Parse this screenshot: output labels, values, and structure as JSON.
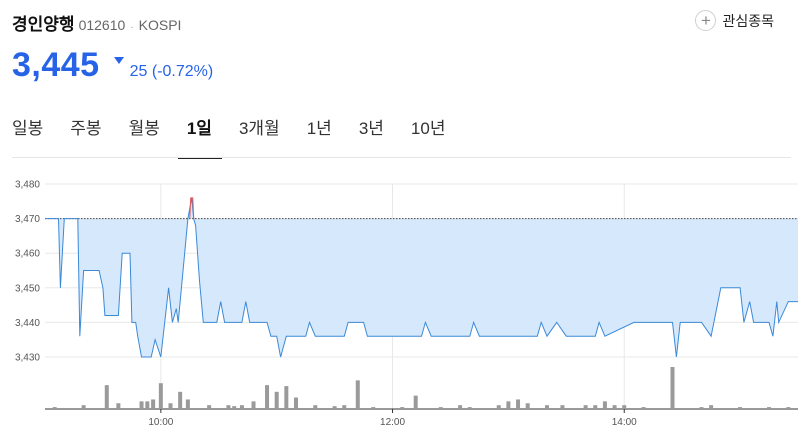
{
  "stock": {
    "name": "경인양행",
    "code": "012610",
    "separator": "·",
    "market": "KOSPI",
    "price": "3,445",
    "change_text": "25 (-0.72%)",
    "direction": "down"
  },
  "watch": {
    "icon": "plus-icon",
    "label": "관심종목"
  },
  "tabs": [
    {
      "label": "일봉"
    },
    {
      "label": "주봉"
    },
    {
      "label": "월봉"
    },
    {
      "label": "1일",
      "active": true
    },
    {
      "label": "3개월"
    },
    {
      "label": "1년"
    },
    {
      "label": "3년"
    },
    {
      "label": "10년"
    }
  ],
  "colors": {
    "accent": "#2763e6",
    "line": "#3b8ad8",
    "fill": "#d6e8fb",
    "peak": "#e05555",
    "volume": "#9a9a9a"
  },
  "chart_data": {
    "type": "line",
    "y_ticks": [
      "3,480",
      "3,470",
      "3,460",
      "3,450",
      "3,440",
      "3,430"
    ],
    "x_ticks": [
      "10:00",
      "12:00",
      "14:00"
    ],
    "ylim": [
      3430,
      3480
    ],
    "reference_price": 3470,
    "time_range": [
      "09:00",
      "15:30"
    ],
    "price_series": [
      [
        "09:00",
        3470
      ],
      [
        "09:07",
        3470
      ],
      [
        "09:08",
        3450
      ],
      [
        "09:10",
        3470
      ],
      [
        "09:15",
        3470
      ],
      [
        "09:17",
        3470
      ],
      [
        "09:18",
        3436
      ],
      [
        "09:20",
        3455
      ],
      [
        "09:28",
        3455
      ],
      [
        "09:30",
        3450
      ],
      [
        "09:31",
        3442
      ],
      [
        "09:38",
        3442
      ],
      [
        "09:40",
        3460
      ],
      [
        "09:44",
        3460
      ],
      [
        "09:45",
        3440
      ],
      [
        "09:47",
        3440
      ],
      [
        "09:48",
        3436
      ],
      [
        "09:50",
        3430
      ],
      [
        "09:55",
        3430
      ],
      [
        "09:57",
        3435
      ],
      [
        "10:00",
        3430
      ],
      [
        "10:04",
        3450
      ],
      [
        "10:06",
        3440
      ],
      [
        "10:08",
        3444
      ],
      [
        "10:09",
        3440
      ],
      [
        "10:14",
        3470
      ],
      [
        "10:16",
        3476
      ],
      [
        "10:17",
        3470
      ],
      [
        "10:18",
        3468
      ],
      [
        "10:20",
        3452
      ],
      [
        "10:22",
        3440
      ],
      [
        "10:29",
        3440
      ],
      [
        "10:31",
        3446
      ],
      [
        "10:33",
        3440
      ],
      [
        "10:42",
        3440
      ],
      [
        "10:44",
        3446
      ],
      [
        "10:46",
        3440
      ],
      [
        "10:55",
        3440
      ],
      [
        "10:57",
        3436
      ],
      [
        "11:00",
        3436
      ],
      [
        "11:02",
        3430
      ],
      [
        "11:05",
        3436
      ],
      [
        "11:15",
        3436
      ],
      [
        "11:17",
        3440
      ],
      [
        "11:20",
        3436
      ],
      [
        "11:35",
        3436
      ],
      [
        "11:37",
        3440
      ],
      [
        "11:45",
        3440
      ],
      [
        "11:47",
        3436
      ],
      [
        "12:15",
        3436
      ],
      [
        "12:17",
        3440
      ],
      [
        "12:20",
        3436
      ],
      [
        "12:40",
        3436
      ],
      [
        "12:42",
        3440
      ],
      [
        "12:45",
        3436
      ],
      [
        "13:15",
        3436
      ],
      [
        "13:17",
        3440
      ],
      [
        "13:20",
        3436
      ],
      [
        "13:25",
        3440
      ],
      [
        "13:30",
        3436
      ],
      [
        "13:45",
        3436
      ],
      [
        "13:47",
        3440
      ],
      [
        "13:50",
        3436
      ],
      [
        "14:05",
        3440
      ],
      [
        "14:25",
        3440
      ],
      [
        "14:27",
        3430
      ],
      [
        "14:29",
        3440
      ],
      [
        "14:40",
        3440
      ],
      [
        "14:45",
        3436
      ],
      [
        "14:50",
        3450
      ],
      [
        "15:00",
        3450
      ],
      [
        "15:02",
        3440
      ],
      [
        "15:05",
        3446
      ],
      [
        "15:07",
        3440
      ],
      [
        "15:15",
        3440
      ],
      [
        "15:17",
        3436
      ],
      [
        "15:19",
        3446
      ],
      [
        "15:20",
        3440
      ],
      [
        "15:25",
        3446
      ],
      [
        "15:30",
        3446
      ]
    ],
    "volume_series": [
      [
        "09:05",
        2
      ],
      [
        "09:20",
        4
      ],
      [
        "09:32",
        25
      ],
      [
        "09:38",
        6
      ],
      [
        "09:50",
        8
      ],
      [
        "09:53",
        8
      ],
      [
        "09:56",
        10
      ],
      [
        "10:00",
        27
      ],
      [
        "10:05",
        6
      ],
      [
        "10:10",
        18
      ],
      [
        "10:14",
        10
      ],
      [
        "10:25",
        4
      ],
      [
        "10:35",
        4
      ],
      [
        "10:38",
        3
      ],
      [
        "10:42",
        4
      ],
      [
        "10:48",
        8
      ],
      [
        "10:55",
        25
      ],
      [
        "11:00",
        18
      ],
      [
        "11:05",
        24
      ],
      [
        "11:10",
        12
      ],
      [
        "11:20",
        4
      ],
      [
        "11:30",
        3
      ],
      [
        "11:35",
        4
      ],
      [
        "11:42",
        30
      ],
      [
        "11:50",
        2
      ],
      [
        "12:05",
        2
      ],
      [
        "12:12",
        14
      ],
      [
        "12:25",
        2
      ],
      [
        "12:35",
        4
      ],
      [
        "12:40",
        2
      ],
      [
        "12:55",
        4
      ],
      [
        "13:00",
        8
      ],
      [
        "13:05",
        10
      ],
      [
        "13:10",
        6
      ],
      [
        "13:20",
        4
      ],
      [
        "13:28",
        4
      ],
      [
        "13:40",
        4
      ],
      [
        "13:45",
        4
      ],
      [
        "13:50",
        8
      ],
      [
        "13:55",
        4
      ],
      [
        "14:00",
        4
      ],
      [
        "14:10",
        2
      ],
      [
        "14:25",
        44
      ],
      [
        "14:40",
        2
      ],
      [
        "14:45",
        4
      ],
      [
        "15:00",
        2
      ],
      [
        "15:15",
        2
      ],
      [
        "15:25",
        2
      ]
    ]
  }
}
